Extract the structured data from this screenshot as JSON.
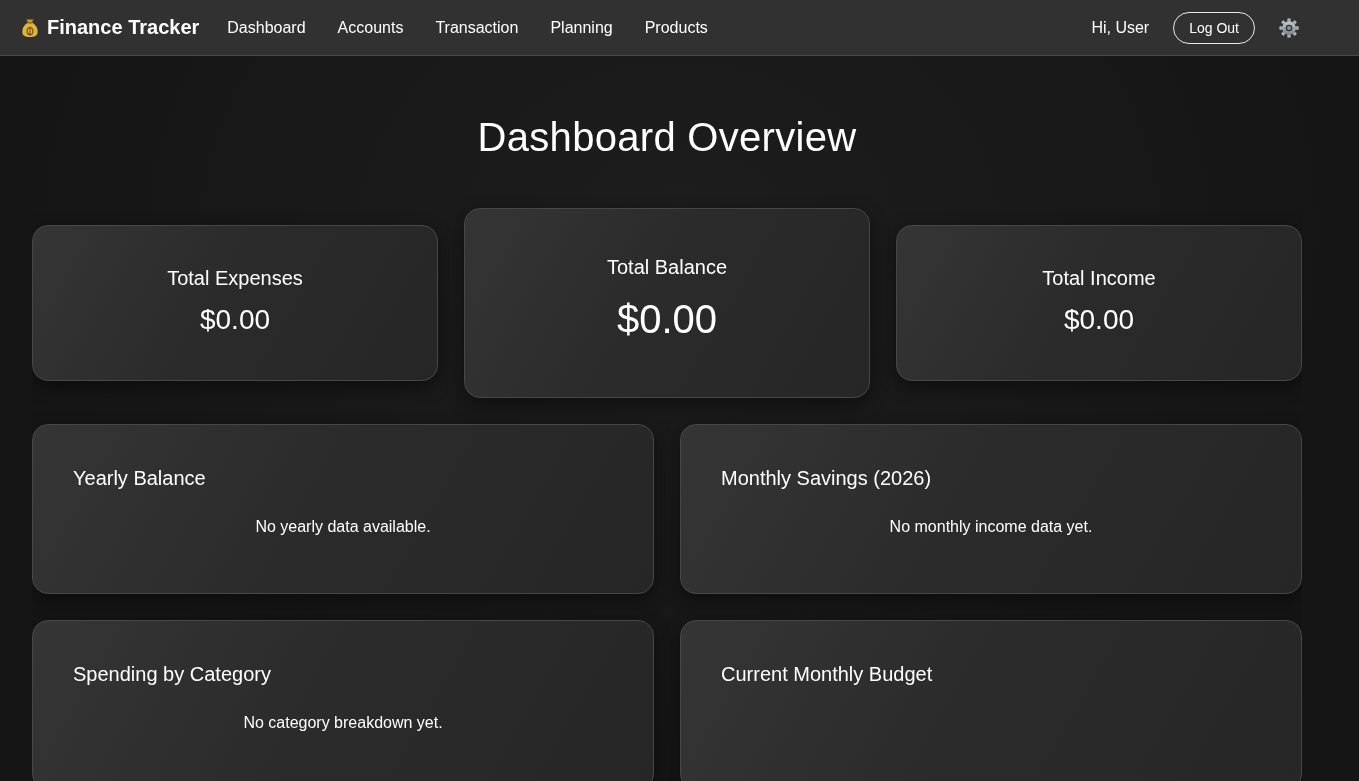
{
  "navbar": {
    "brand": "Finance Tracker",
    "links": [
      "Dashboard",
      "Accounts",
      "Transaction",
      "Planning",
      "Products"
    ],
    "greeting": "Hi, User",
    "logout_button": "Log Out"
  },
  "page_title": "Dashboard Overview",
  "summary_cards": [
    {
      "title": "Total Expenses",
      "value": "$0.00",
      "featured": false
    },
    {
      "title": "Total Balance",
      "value": "$0.00",
      "featured": true
    },
    {
      "title": "Total Income",
      "value": "$0.00",
      "featured": false
    }
  ],
  "panels": [
    {
      "title": "Yearly Balance",
      "message": "No yearly data available."
    },
    {
      "title": "Monthly Savings (2026)",
      "message": "No monthly income data yet."
    },
    {
      "title": "Spending by Category",
      "message": "No category breakdown yet."
    },
    {
      "title": "Current Monthly Budget"
    }
  ]
}
